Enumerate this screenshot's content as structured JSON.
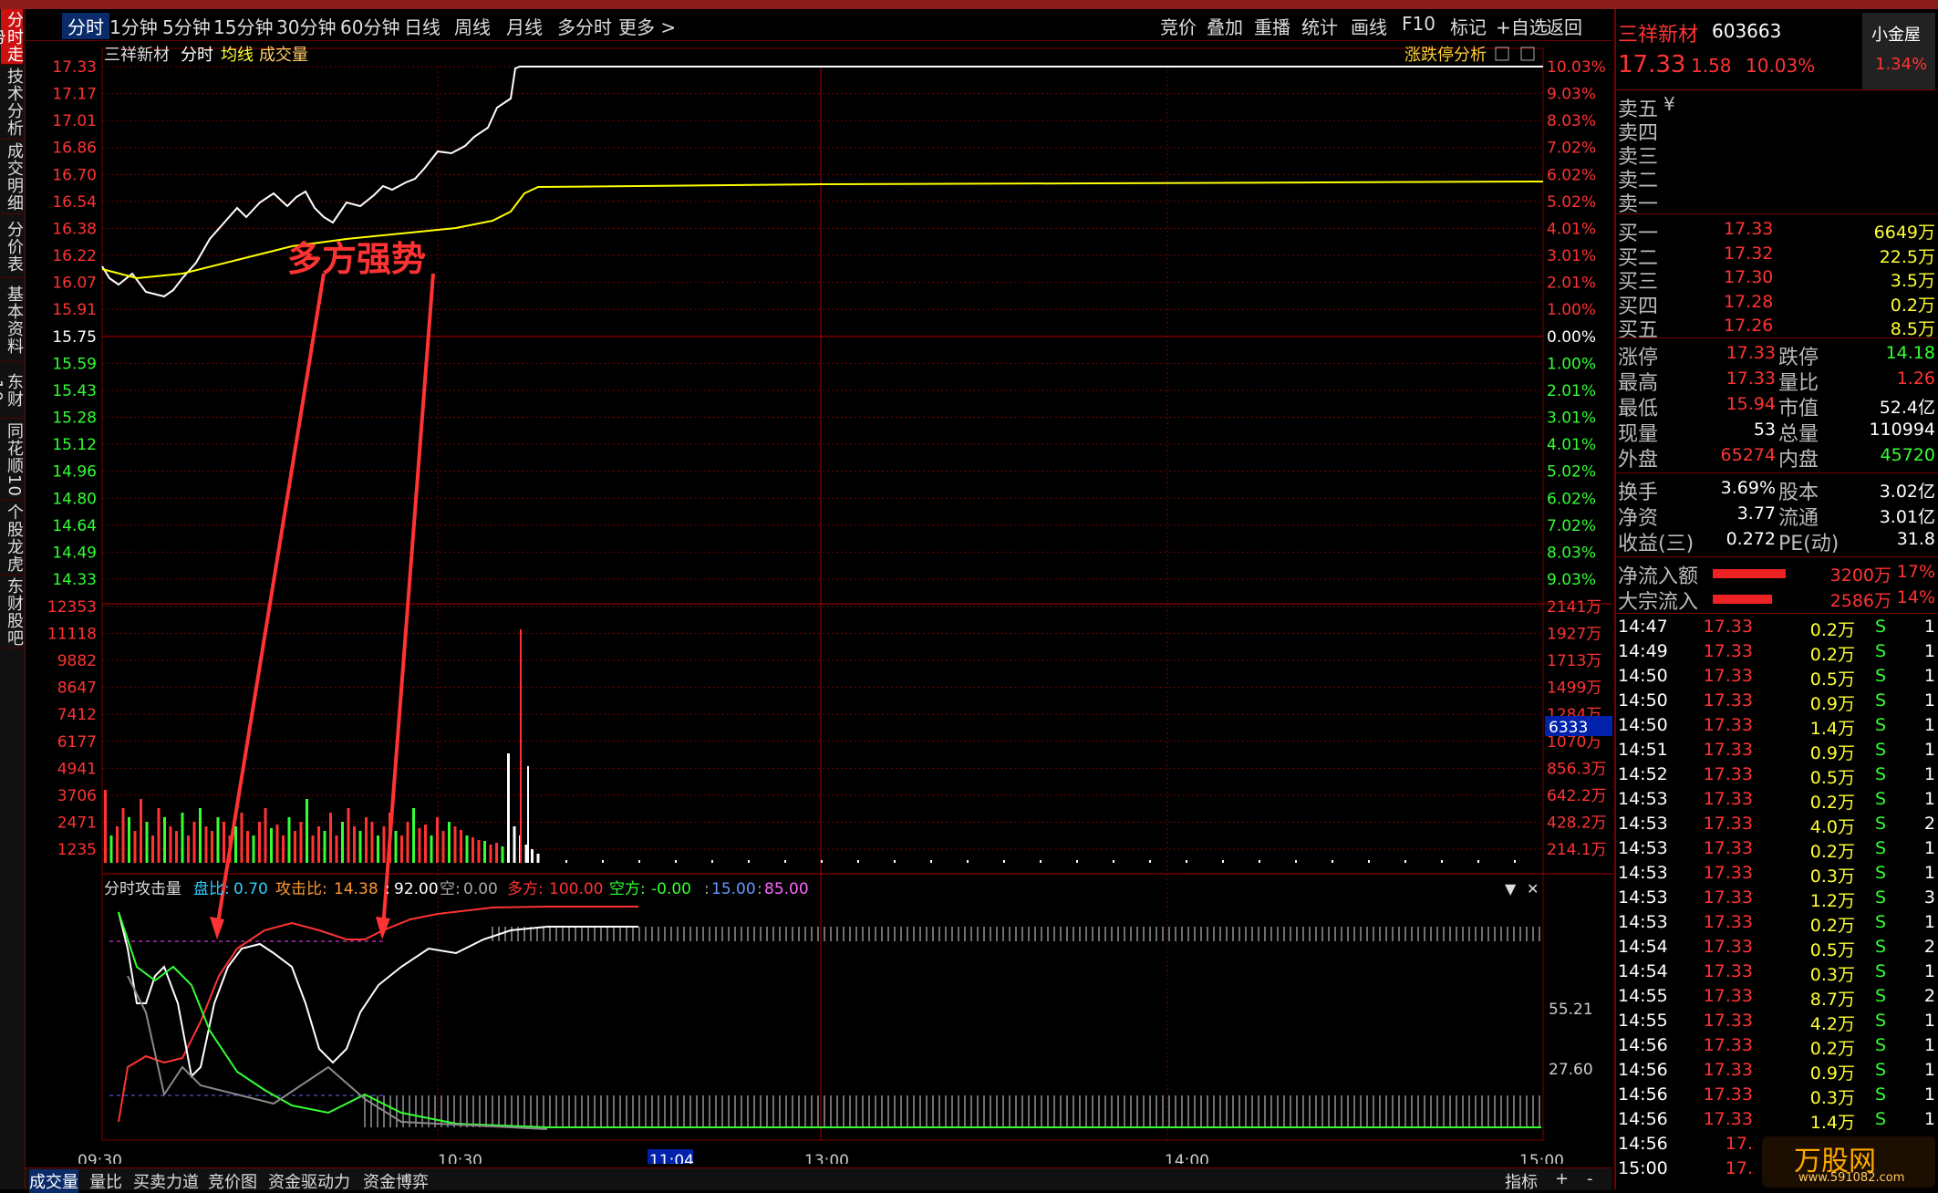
{
  "toolbar": {
    "periods": [
      "分时",
      "1分钟",
      "5分钟",
      "15分钟",
      "30分钟",
      "60分钟",
      "日线",
      "周线",
      "月线",
      "多分时",
      "更多 >"
    ],
    "actions": [
      "竞价",
      "叠加",
      "重播",
      "统计",
      "画线",
      "F10",
      "标记",
      "+自选",
      "返回"
    ]
  },
  "left_tabs": [
    "分时走势",
    "技术分析",
    "成交明细",
    "分价表",
    "基本资料",
    "东财10",
    "同花顺10",
    "个股龙虎",
    "东财股吧"
  ],
  "chart": {
    "legend_name": "三祥新材",
    "legend_mode": "分时",
    "legend_avg": "均线",
    "legend_vol": "成交量",
    "analysis_link": "涨跌停分析",
    "annotation": "多方强势",
    "price_ticks": [
      "17.33",
      "17.17",
      "17.01",
      "16.86",
      "16.70",
      "16.54",
      "16.38",
      "16.22",
      "16.07",
      "15.91",
      "15.75",
      "15.59",
      "15.43",
      "15.28",
      "15.12",
      "14.96",
      "14.80",
      "14.64",
      "14.49",
      "14.33"
    ],
    "pct_ticks": [
      "10.03%",
      "9.03%",
      "8.03%",
      "7.02%",
      "6.02%",
      "5.02%",
      "4.01%",
      "3.01%",
      "2.01%",
      "1.00%",
      "0.00%",
      "1.00%",
      "2.01%",
      "3.01%",
      "4.01%",
      "5.02%",
      "6.02%",
      "7.02%",
      "8.03%",
      "9.03%"
    ],
    "vol_ticks": [
      "12353",
      "11118",
      "9882",
      "8647",
      "7412",
      "6177",
      "4941",
      "3706",
      "2471",
      "1235"
    ],
    "amt_ticks": [
      "2141万",
      "1927万",
      "1713万",
      "1499万",
      "1284万",
      "1070万",
      "856.3万",
      "642.2万",
      "428.2万",
      "214.1万"
    ],
    "vol_cursor": "6333",
    "time_ticks": [
      "09:30",
      "10:30",
      "11:04",
      "13:00",
      "14:00",
      "15:00"
    ],
    "indicator": {
      "name": "分时攻击量",
      "pankou_label": "盘比:",
      "pankou_value": "0.70",
      "attack_label": "攻击比:",
      "attack_value": "14.38",
      "y_label": ":",
      "y_value": "92.00",
      "kong_label": "空:",
      "kong_value": "0.00",
      "duo_label": "多方:",
      "duo_value": "100.00",
      "kongfang_label": "空方:",
      "kongfang_value": "-0.00",
      "v1": "15.00",
      "v2": "85.00",
      "levels": [
        "55.21",
        "27.60"
      ]
    },
    "colors": {
      "price_line": "#ffffff",
      "avg_line": "#ffff00",
      "up": "#ff3333",
      "down": "#33ff33",
      "grid": "#7a0000"
    }
  },
  "stock": {
    "name": "三祥新材",
    "code": "603663",
    "price": "17.33",
    "change": "1.58",
    "pct": "10.03%",
    "brand": "小金屋",
    "brand_pct": "1.34%"
  },
  "asks": [
    {
      "label": "卖五",
      "price": "¥",
      "vol": ""
    },
    {
      "label": "卖四",
      "price": "",
      "vol": ""
    },
    {
      "label": "卖三",
      "price": "",
      "vol": ""
    },
    {
      "label": "卖二",
      "price": "",
      "vol": ""
    },
    {
      "label": "卖一",
      "price": "",
      "vol": ""
    }
  ],
  "bids": [
    {
      "label": "买一",
      "price": "17.33",
      "vol": "6649万"
    },
    {
      "label": "买二",
      "price": "17.32",
      "vol": "22.5万"
    },
    {
      "label": "买三",
      "price": "17.30",
      "vol": "3.5万"
    },
    {
      "label": "买四",
      "price": "17.28",
      "vol": "0.2万"
    },
    {
      "label": "买五",
      "price": "17.26",
      "vol": "8.5万"
    }
  ],
  "stats": [
    {
      "l1": "涨停",
      "v1": "17.33",
      "l2": "跌停",
      "v2": "14.18"
    },
    {
      "l1": "最高",
      "v1": "17.33",
      "l2": "量比",
      "v2": "1.26"
    },
    {
      "l1": "最低",
      "v1": "15.94",
      "l2": "市值",
      "v2": "52.4亿"
    },
    {
      "l1": "现量",
      "v1": "53",
      "l2": "总量",
      "v2": "110994"
    },
    {
      "l1": "外盘",
      "v1": "65274",
      "l2": "内盘",
      "v2": "45720"
    }
  ],
  "stats2": [
    {
      "l1": "换手",
      "v1": "3.69%",
      "l2": "股本",
      "v2": "3.02亿"
    },
    {
      "l1": "净资",
      "v1": "3.77",
      "l2": "流通",
      "v2": "3.01亿"
    },
    {
      "l1": "收益(三)",
      "v1": "0.272",
      "l2": "PE(动)",
      "v2": "31.8"
    }
  ],
  "flows": [
    {
      "label": "净流入额",
      "value": "3200万",
      "pct": "17%",
      "fill": 0.8
    },
    {
      "label": "大宗流入",
      "value": "2586万",
      "pct": "14%",
      "fill": 0.65
    }
  ],
  "ticks": [
    {
      "t": "14:47",
      "p": "17.33",
      "v": "0.2万",
      "s": "S",
      "n": "1"
    },
    {
      "t": "14:49",
      "p": "17.33",
      "v": "0.2万",
      "s": "S",
      "n": "1"
    },
    {
      "t": "14:50",
      "p": "17.33",
      "v": "0.5万",
      "s": "S",
      "n": "1"
    },
    {
      "t": "14:50",
      "p": "17.33",
      "v": "0.9万",
      "s": "S",
      "n": "1"
    },
    {
      "t": "14:50",
      "p": "17.33",
      "v": "1.4万",
      "s": "S",
      "n": "1"
    },
    {
      "t": "14:51",
      "p": "17.33",
      "v": "0.9万",
      "s": "S",
      "n": "1"
    },
    {
      "t": "14:52",
      "p": "17.33",
      "v": "0.5万",
      "s": "S",
      "n": "1"
    },
    {
      "t": "14:53",
      "p": "17.33",
      "v": "0.2万",
      "s": "S",
      "n": "1"
    },
    {
      "t": "14:53",
      "p": "17.33",
      "v": "4.0万",
      "s": "S",
      "n": "2"
    },
    {
      "t": "14:53",
      "p": "17.33",
      "v": "0.2万",
      "s": "S",
      "n": "1"
    },
    {
      "t": "14:53",
      "p": "17.33",
      "v": "0.3万",
      "s": "S",
      "n": "1"
    },
    {
      "t": "14:53",
      "p": "17.33",
      "v": "1.2万",
      "s": "S",
      "n": "3"
    },
    {
      "t": "14:53",
      "p": "17.33",
      "v": "0.2万",
      "s": "S",
      "n": "1"
    },
    {
      "t": "14:54",
      "p": "17.33",
      "v": "0.5万",
      "s": "S",
      "n": "2"
    },
    {
      "t": "14:54",
      "p": "17.33",
      "v": "0.3万",
      "s": "S",
      "n": "1"
    },
    {
      "t": "14:55",
      "p": "17.33",
      "v": "8.7万",
      "s": "S",
      "n": "2"
    },
    {
      "t": "14:55",
      "p": "17.33",
      "v": "4.2万",
      "s": "S",
      "n": "1"
    },
    {
      "t": "14:56",
      "p": "17.33",
      "v": "0.2万",
      "s": "S",
      "n": "1"
    },
    {
      "t": "14:56",
      "p": "17.33",
      "v": "0.9万",
      "s": "S",
      "n": "1"
    },
    {
      "t": "14:56",
      "p": "17.33",
      "v": "0.3万",
      "s": "S",
      "n": "1"
    },
    {
      "t": "14:56",
      "p": "17.33",
      "v": "1.4万",
      "s": "S",
      "n": "1"
    },
    {
      "t": "14:56",
      "p": "17.",
      "v": "",
      "s": "",
      "n": ""
    },
    {
      "t": "15:00",
      "p": "17.",
      "v": "",
      "s": "",
      "n": ""
    }
  ],
  "watermark": "万股网",
  "watermark_url": "www.591082.com",
  "bottom_tabs": [
    "成交量",
    "量比",
    "买卖力道",
    "竞价图",
    "资金驱动力",
    "资金博弈"
  ],
  "bottom_right": [
    "指标",
    "+",
    "-"
  ]
}
